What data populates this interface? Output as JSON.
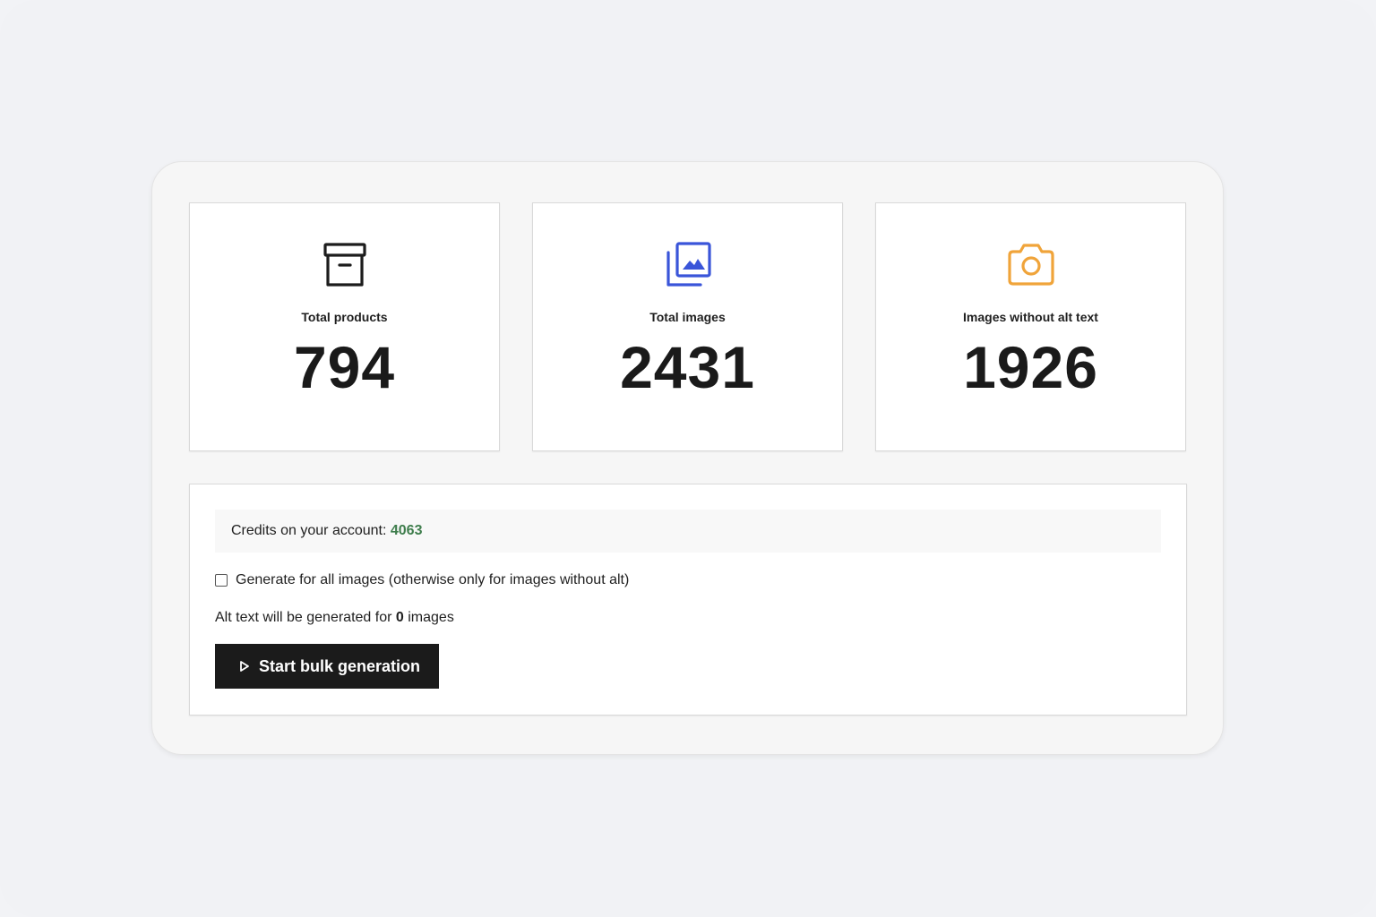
{
  "stats": [
    {
      "label": "Total products",
      "value": "794",
      "icon": "archive-box-icon",
      "icon_color": "#1c1c1c"
    },
    {
      "label": "Total images",
      "value": "2431",
      "icon": "image-gallery-icon",
      "icon_color": "#3a55d9"
    },
    {
      "label": "Images without alt text",
      "value": "1926",
      "icon": "camera-icon",
      "icon_color": "#f0a43a"
    }
  ],
  "credits": {
    "label": "Credits on your account:",
    "value": "4063",
    "value_color": "#3e7d4c"
  },
  "generate_all": {
    "label": "Generate for all images (otherwise only for images without alt)",
    "checked": false
  },
  "summary": {
    "prefix": "Alt text will be generated for",
    "count": "0",
    "suffix": "images"
  },
  "start_button": {
    "label": "Start bulk generation",
    "icon": "play-icon"
  }
}
